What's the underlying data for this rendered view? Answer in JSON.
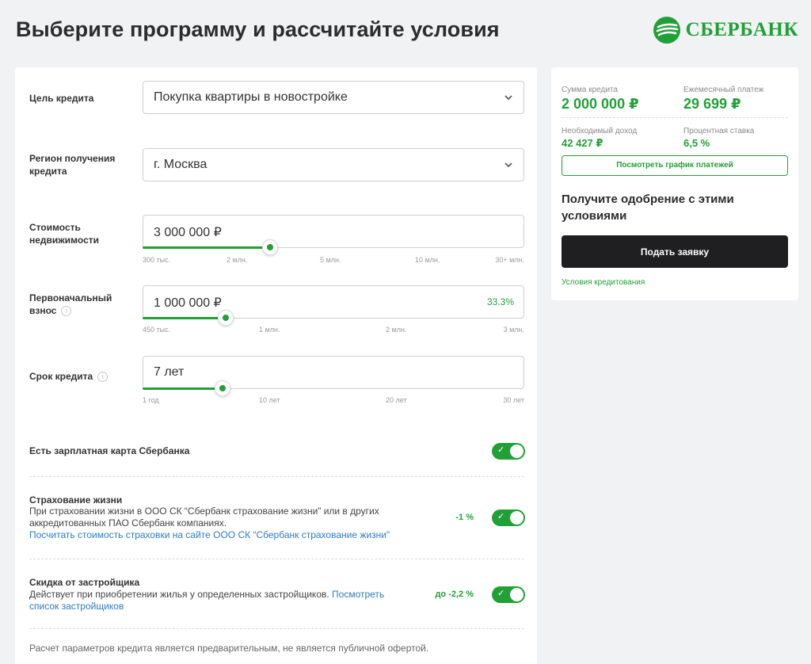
{
  "header": {
    "title": "Выберите программу и рассчитайте условия",
    "brand": "СБЕРБАНК",
    "brand_color": "#21a038"
  },
  "form": {
    "purpose": {
      "label": "Цель кредита",
      "value": "Покупка квартиры в новостройке",
      "icon": "chevron-down-icon"
    },
    "region": {
      "label": "Регион получения кредита",
      "value": "г. Москва",
      "icon": "chevron-down-icon"
    },
    "property_cost": {
      "label": "Стоимость недвижимости",
      "value": "3 000 000 ₽",
      "slider_fraction": 0.33,
      "ticks": [
        "300 тыс.",
        "2 млн.",
        "5 млн.",
        "10 млн.",
        "30+ млн."
      ]
    },
    "down_payment": {
      "label": "Первоначальный взнос",
      "value": "1 000 000 ₽",
      "percent": "33.3%",
      "slider_fraction": 0.22,
      "ticks": [
        "450 тыс.",
        "1 млн.",
        "2 млн.",
        "3 млн."
      ]
    },
    "term": {
      "label": "Срок кредита",
      "value": "7 лет",
      "slider_fraction": 0.21,
      "ticks": [
        "1 год",
        "10 лет",
        "20 лет",
        "30 лет"
      ]
    }
  },
  "options": {
    "salary_card": {
      "title": "Есть зарплатная карта Сбербанка",
      "enabled": true
    },
    "life_insurance": {
      "title": "Страхование жизни",
      "desc": "При страховании жизни в ООО СК “Сбербанк страхование жизни” или в других аккредитованных ПАО Сбербанк компаниях.",
      "link": "Посчитать стоимость страховки на сайте ООО СК “Сбербанк страхование жизни”",
      "discount": "-1 %",
      "enabled": true
    },
    "developer_discount": {
      "title": "Скидка от застройщика",
      "desc": "Действует при приобретении жилья у определенных застройщиков.",
      "link": "Посмотреть список застройщиков",
      "discount": "до -2,2 %",
      "enabled": true
    }
  },
  "disclaimer": "Расчет параметров кредита является предварительным, не является публичной офертой.",
  "summary": {
    "loan_amount_label": "Сумма кредита",
    "loan_amount": "2 000 000 ₽",
    "monthly_payment_label": "Ежемесячный платеж",
    "monthly_payment": "29 699 ₽",
    "income_label": "Необходимый доход",
    "income": "42 427 ₽",
    "rate_label": "Процентная ставка",
    "rate": "6,5 %",
    "schedule_button": "Посмотреть график платежей",
    "approval_text": "Получите одобрение с этими условиями",
    "apply_button": "Подать заявку",
    "terms_link": "Условия кредитования"
  }
}
